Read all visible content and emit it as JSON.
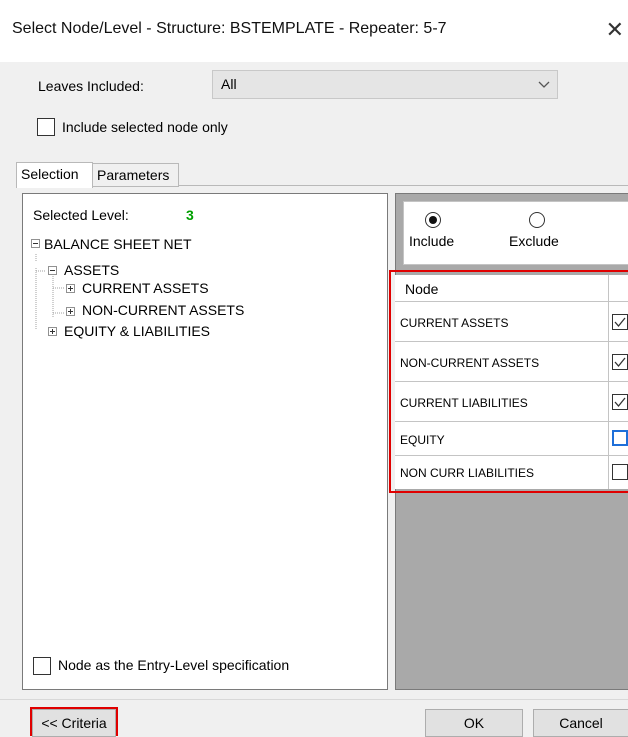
{
  "window": {
    "title": "Select Node/Level - Structure: BSTEMPLATE - Repeater: 5-7",
    "close_glyph": "✕"
  },
  "leaves": {
    "label": "Leaves Included:",
    "value": "All"
  },
  "include_selected_only": {
    "label": "Include selected node only",
    "checked": false
  },
  "tabs": [
    "Selection",
    "Parameters"
  ],
  "selected_level": {
    "label": "Selected Level:",
    "value": "3",
    "value_color": "#00a000"
  },
  "tree": [
    {
      "label": "BALANCE SHEET NET",
      "expander": "minus"
    },
    {
      "label": "ASSETS",
      "expander": "minus"
    },
    {
      "label": "CURRENT ASSETS",
      "expander": "plus"
    },
    {
      "label": "NON-CURRENT ASSETS",
      "expander": "plus"
    },
    {
      "label": "EQUITY & LIABILITIES",
      "expander": "plus"
    }
  ],
  "entry_level": {
    "label": "Node as the Entry-Level specification",
    "checked": false
  },
  "mode": {
    "include_label": "Include",
    "exclude_label": "Exclude",
    "selected": "Include"
  },
  "grid": {
    "header": "Node",
    "rows": [
      {
        "name": "CURRENT ASSETS",
        "checked": true
      },
      {
        "name": "NON-CURRENT ASSETS",
        "checked": true
      },
      {
        "name": "CURRENT LIABILITIES",
        "checked": true
      },
      {
        "name": "EQUITY",
        "checked": false,
        "focused": true
      },
      {
        "name": "NON CURR LIABILITIES",
        "checked": false
      }
    ]
  },
  "buttons": {
    "criteria": "<< Criteria",
    "ok": "OK",
    "cancel": "Cancel"
  },
  "colors": {
    "highlight_red": "#e00000",
    "focus_blue": "#1e6fd9"
  }
}
